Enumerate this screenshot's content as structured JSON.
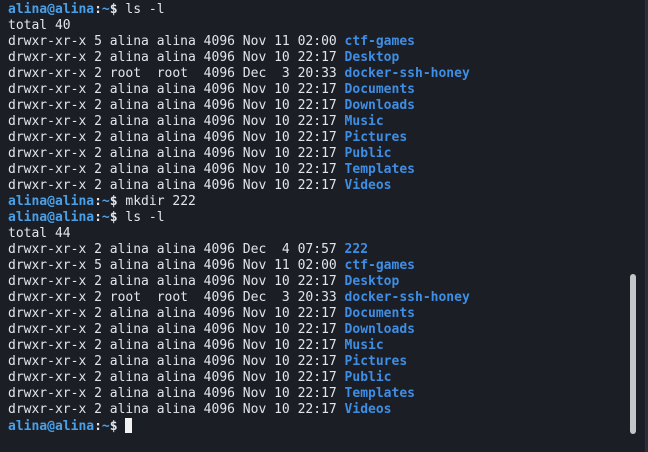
{
  "prompt": {
    "user": "alina@alina",
    "sep": ":",
    "path": "~",
    "symbol": "$"
  },
  "lines": [
    {
      "kind": "prompt",
      "cmd": "ls -l"
    },
    {
      "kind": "text",
      "text": "total 40"
    },
    {
      "kind": "entry",
      "meta": "drwxr-xr-x 5 alina alina 4096 Nov 11 02:00 ",
      "name": "ctf-games"
    },
    {
      "kind": "entry",
      "meta": "drwxr-xr-x 2 alina alina 4096 Nov 10 22:17 ",
      "name": "Desktop"
    },
    {
      "kind": "entry",
      "meta": "drwxr-xr-x 2 root  root  4096 Dec  3 20:33 ",
      "name": "docker-ssh-honey"
    },
    {
      "kind": "entry",
      "meta": "drwxr-xr-x 2 alina alina 4096 Nov 10 22:17 ",
      "name": "Documents"
    },
    {
      "kind": "entry",
      "meta": "drwxr-xr-x 2 alina alina 4096 Nov 10 22:17 ",
      "name": "Downloads"
    },
    {
      "kind": "entry",
      "meta": "drwxr-xr-x 2 alina alina 4096 Nov 10 22:17 ",
      "name": "Music"
    },
    {
      "kind": "entry",
      "meta": "drwxr-xr-x 2 alina alina 4096 Nov 10 22:17 ",
      "name": "Pictures"
    },
    {
      "kind": "entry",
      "meta": "drwxr-xr-x 2 alina alina 4096 Nov 10 22:17 ",
      "name": "Public"
    },
    {
      "kind": "entry",
      "meta": "drwxr-xr-x 2 alina alina 4096 Nov 10 22:17 ",
      "name": "Templates"
    },
    {
      "kind": "entry",
      "meta": "drwxr-xr-x 2 alina alina 4096 Nov 10 22:17 ",
      "name": "Videos"
    },
    {
      "kind": "prompt",
      "cmd": "mkdir 222"
    },
    {
      "kind": "prompt",
      "cmd": "ls -l"
    },
    {
      "kind": "text",
      "text": "total 44"
    },
    {
      "kind": "entry",
      "meta": "drwxr-xr-x 2 alina alina 4096 Dec  4 07:57 ",
      "name": "222"
    },
    {
      "kind": "entry",
      "meta": "drwxr-xr-x 5 alina alina 4096 Nov 11 02:00 ",
      "name": "ctf-games"
    },
    {
      "kind": "entry",
      "meta": "drwxr-xr-x 2 alina alina 4096 Nov 10 22:17 ",
      "name": "Desktop"
    },
    {
      "kind": "entry",
      "meta": "drwxr-xr-x 2 root  root  4096 Dec  3 20:33 ",
      "name": "docker-ssh-honey"
    },
    {
      "kind": "entry",
      "meta": "drwxr-xr-x 2 alina alina 4096 Nov 10 22:17 ",
      "name": "Documents"
    },
    {
      "kind": "entry",
      "meta": "drwxr-xr-x 2 alina alina 4096 Nov 10 22:17 ",
      "name": "Downloads"
    },
    {
      "kind": "entry",
      "meta": "drwxr-xr-x 2 alina alina 4096 Nov 10 22:17 ",
      "name": "Music"
    },
    {
      "kind": "entry",
      "meta": "drwxr-xr-x 2 alina alina 4096 Nov 10 22:17 ",
      "name": "Pictures"
    },
    {
      "kind": "entry",
      "meta": "drwxr-xr-x 2 alina alina 4096 Nov 10 22:17 ",
      "name": "Public"
    },
    {
      "kind": "entry",
      "meta": "drwxr-xr-x 2 alina alina 4096 Nov 10 22:17 ",
      "name": "Templates"
    },
    {
      "kind": "entry",
      "meta": "drwxr-xr-x 2 alina alina 4096 Nov 10 22:17 ",
      "name": "Videos"
    },
    {
      "kind": "prompt",
      "cmd": ""
    }
  ],
  "colors": {
    "background": "#1c1e26",
    "prompt": "#4aa0e6",
    "directory": "#3e8ee5",
    "text": "#e3e5ea"
  }
}
